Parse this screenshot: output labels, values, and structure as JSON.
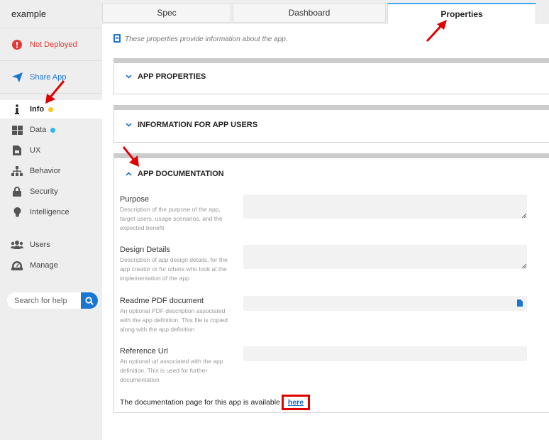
{
  "app": {
    "title": "example"
  },
  "sidebar": {
    "items": [
      {
        "label": "Not Deployed",
        "icon": "alert-icon",
        "color": "#e53935"
      },
      {
        "label": "Share App",
        "icon": "send-icon",
        "color": "#1976d2"
      },
      {
        "label": "Info",
        "icon": "info-icon",
        "dot": "#f9c623"
      },
      {
        "label": "Data",
        "icon": "grid-icon",
        "dot": "#29b6f6"
      },
      {
        "label": "UX",
        "icon": "ux-icon"
      },
      {
        "label": "Behavior",
        "icon": "hierarchy-icon"
      },
      {
        "label": "Security",
        "icon": "lock-icon"
      },
      {
        "label": "Intelligence",
        "icon": "bulb-icon"
      },
      {
        "label": "Users",
        "icon": "users-icon"
      },
      {
        "label": "Manage",
        "icon": "dashboard-icon"
      }
    ],
    "search_placeholder": "Search for help"
  },
  "tabs": [
    {
      "label": "Spec"
    },
    {
      "label": "Dashboard"
    },
    {
      "label": "Properties",
      "active": true
    }
  ],
  "main": {
    "info_text": "These properties provide information about the app.",
    "sections": [
      {
        "title": "APP PROPERTIES",
        "expanded": false
      },
      {
        "title": "INFORMATION FOR APP USERS",
        "expanded": false
      },
      {
        "title": "APP DOCUMENTATION",
        "expanded": true
      }
    ],
    "fields": [
      {
        "label": "Purpose",
        "description": "Description of the purpose of the app, target users, usage scenarios, and the expected benefit",
        "value": ""
      },
      {
        "label": "Design Details",
        "description": "Description of app design details, for the app creator or for others who look at the implementation of the app",
        "value": ""
      },
      {
        "label": "Readme PDF document",
        "description": "An optional PDF description associated with the app definition. This file is copied along with the app definition",
        "value": ""
      },
      {
        "label": "Reference Url",
        "description": "An optional url associated with the app definition. This is used for further documentation",
        "value": ""
      }
    ],
    "doc_text": "The documentation page for this app is available",
    "doc_link": "here"
  },
  "colors": {
    "accent": "#1976d2",
    "alert": "#e53935",
    "annotation_red": "#e00000"
  }
}
